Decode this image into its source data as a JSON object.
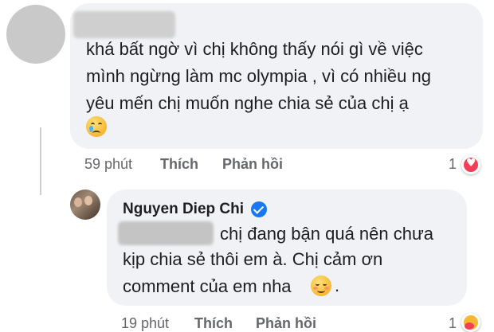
{
  "comment1": {
    "text_lines": [
      "khá bất ngờ vì chị không thấy nói gì về việc",
      "mình ngừng làm mc olympia , vì có nhiều ng",
      "yêu mến chị muốn nghe chia sẻ của chị ạ"
    ],
    "emoji": "crying-face",
    "time": "59 phút",
    "like_label": "Thích",
    "reply_label": "Phản hồi",
    "reaction_count": "1",
    "reaction_type": "heart"
  },
  "comment2": {
    "author": "Nguyen Diep Chi",
    "verified": true,
    "text_lines": [
      "chị đang bận quá nên chưa",
      "kịp chia sẻ thôi em à. Chị cảm ơn",
      "comment của em nha"
    ],
    "emoji": "smiling-face",
    "time": "19 phút",
    "like_label": "Thích",
    "reply_label": "Phản hồi",
    "reaction_count": "1",
    "reaction_type": "care"
  },
  "colors": {
    "bubble": "#f0f2f5",
    "meta_text": "#65676b",
    "text": "#1c1e21",
    "verified": "#1877f2",
    "heart": "#f33e58"
  }
}
